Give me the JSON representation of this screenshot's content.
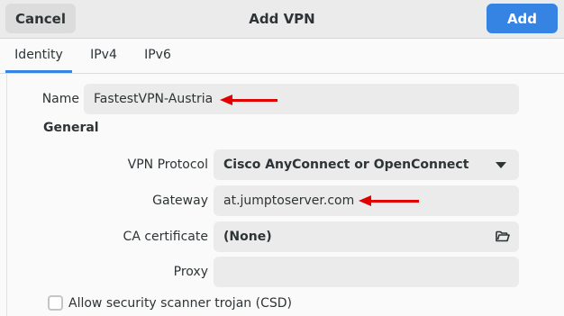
{
  "header": {
    "cancel_label": "Cancel",
    "title": "Add VPN",
    "add_label": "Add",
    "accent_color": "#3584e4"
  },
  "tabs": [
    {
      "label": "Identity",
      "active": true
    },
    {
      "label": "IPv4",
      "active": false
    },
    {
      "label": "IPv6",
      "active": false
    }
  ],
  "form": {
    "name_label": "Name",
    "name_value": "FastestVPN-Austria",
    "section_general": "General",
    "protocol_label": "VPN Protocol",
    "protocol_value": "Cisco AnyConnect or OpenConnect",
    "gateway_label": "Gateway",
    "gateway_value": "at.jumptoserver.com",
    "ca_label": "CA certificate",
    "ca_value": "(None)",
    "proxy_label": "Proxy",
    "proxy_value": "",
    "csd_label": "Allow security scanner trojan (CSD)",
    "csd_checked": false
  },
  "annotations": {
    "arrow_color": "#e00000"
  }
}
